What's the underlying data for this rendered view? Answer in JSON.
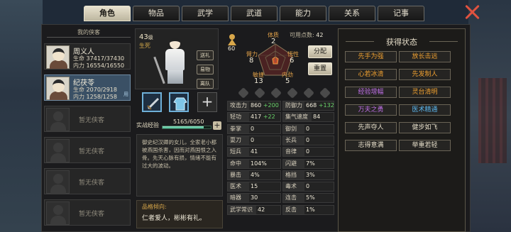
{
  "tabs": [
    {
      "label": "角色",
      "active": true,
      "badge": false
    },
    {
      "label": "物品",
      "active": false,
      "badge": false
    },
    {
      "label": "武学",
      "active": false,
      "badge": true
    },
    {
      "label": "武道",
      "active": false,
      "badge": true
    },
    {
      "label": "能力",
      "active": false,
      "badge": false
    },
    {
      "label": "关系",
      "active": false,
      "badge": false
    },
    {
      "label": "记事",
      "active": false,
      "badge": false
    }
  ],
  "party": {
    "header": "我的侠客",
    "members": [
      {
        "name": "周义人",
        "hp": "37417/37430",
        "mp": "16554/16550",
        "tag": ""
      },
      {
        "name": "纪茯苓",
        "hp": "2070/2918",
        "mp": "1258/1258",
        "tag": "用"
      }
    ],
    "empty_label": "暂无侠客",
    "life_label": "生命",
    "mp_label": "内力"
  },
  "character": {
    "level": "43",
    "level_unit": "级",
    "life": "生死",
    "buttons": [
      "送礼",
      "易物",
      "离队"
    ],
    "xp_label": "实战经验",
    "xp_text": "5165/6050",
    "xp_fraction": 0.854,
    "bio": "御史纪汉卿的女儿，全家老小都被燕国杀害，因而对燕国恨之入骨。先天心脉有损，情绪不能有过大的波动。",
    "trait_label": "品格倾向:",
    "trait_value": "仁者爱人，彬彬有礼。"
  },
  "attrs": {
    "points_label": "可用点数:",
    "points": "42",
    "potential": "60",
    "tizhi_label": "体质",
    "tizhi": "2",
    "biili_label": "臂力",
    "biili": "8",
    "wuxing_label": "悟性",
    "wuxing": "6",
    "minjie_label": "敏捷",
    "minjie": "13",
    "neili_label": "内劲",
    "neili": "5",
    "assign": "分配",
    "reset": "重置"
  },
  "stats": [
    {
      "k": "攻击力",
      "v": "860",
      "b": "+200"
    },
    {
      "k": "防御力",
      "v": "668",
      "b": "+132"
    },
    {
      "k": "轻功",
      "v": "417",
      "b": "+22"
    },
    {
      "k": "集气速度",
      "v": "84",
      "b": ""
    },
    {
      "k": "拳掌",
      "v": "0",
      "b": ""
    },
    {
      "k": "御剑",
      "v": "0",
      "b": ""
    },
    {
      "k": "耍刀",
      "v": "0",
      "b": ""
    },
    {
      "k": "长兵",
      "v": "0",
      "b": ""
    },
    {
      "k": "短兵",
      "v": "41",
      "b": ""
    },
    {
      "k": "音律",
      "v": "0",
      "b": ""
    },
    {
      "k": "命中",
      "v": "104%",
      "b": ""
    },
    {
      "k": "闪避",
      "v": "7%",
      "b": ""
    },
    {
      "k": "暴击",
      "v": "4%",
      "b": ""
    },
    {
      "k": "格挡",
      "v": "3%",
      "b": ""
    },
    {
      "k": "医术",
      "v": "15",
      "b": ""
    },
    {
      "k": "毒术",
      "v": "0",
      "b": ""
    },
    {
      "k": "暗器",
      "v": "30",
      "b": ""
    },
    {
      "k": "连击",
      "v": "5%",
      "b": ""
    },
    {
      "k": "武学常识",
      "v": "42",
      "b": ""
    },
    {
      "k": "反击",
      "v": "1%",
      "b": ""
    }
  ],
  "status": {
    "header": "获得状态",
    "items": [
      {
        "t": "先手为强",
        "c": "#f0a030"
      },
      {
        "t": "放长击远",
        "c": "#f0a030"
      },
      {
        "t": "心若冰清",
        "c": "#f0a030"
      },
      {
        "t": "先发制人",
        "c": "#f0a030"
      },
      {
        "t": "经验增幅",
        "c": "#c070e8"
      },
      {
        "t": "灵台清明",
        "c": "#f0a030"
      },
      {
        "t": "万夫之勇",
        "c": "#c070e8"
      },
      {
        "t": "医术精通",
        "c": "#5cb8f0"
      },
      {
        "t": "先声夺人",
        "c": "#e6dec9"
      },
      {
        "t": "健步如飞",
        "c": "#e6dec9"
      },
      {
        "t": "志得意满",
        "c": "#e6dec9"
      },
      {
        "t": "举重若轻",
        "c": "#e6dec9"
      }
    ]
  }
}
